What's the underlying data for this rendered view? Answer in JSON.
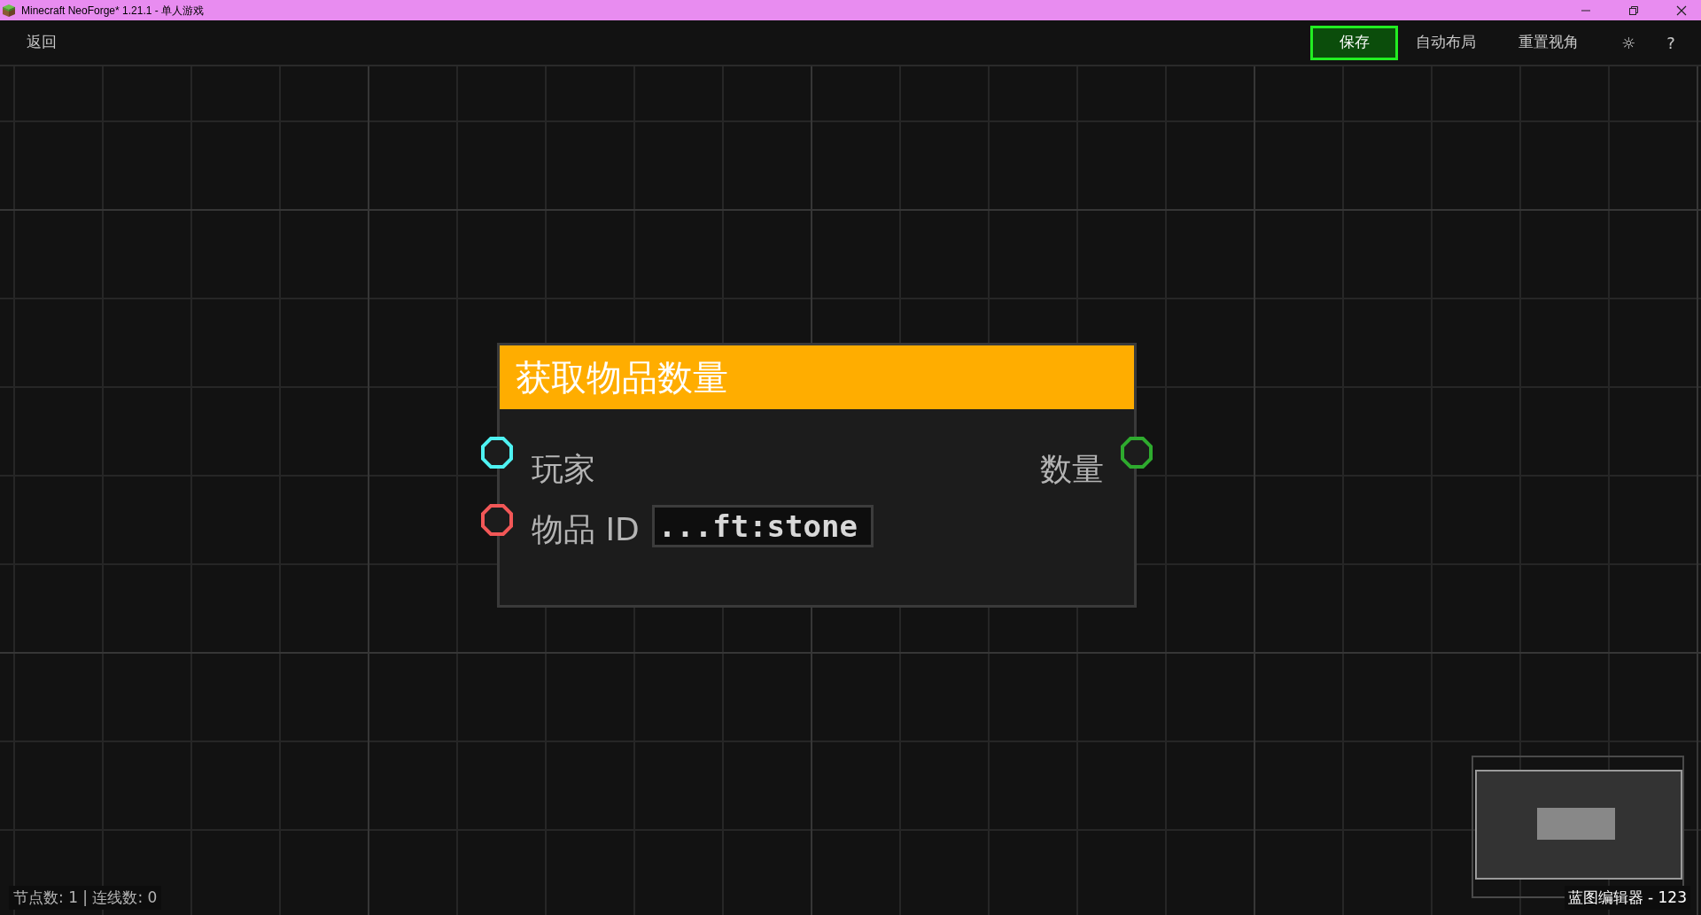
{
  "window": {
    "title": "Minecraft NeoForge* 1.21.1 - 单人游戏"
  },
  "toolbar": {
    "back": "返回",
    "buttons": [
      {
        "label": "保存",
        "kind": "primary"
      },
      {
        "label": "自动布局",
        "kind": "plain"
      },
      {
        "label": "重置视角",
        "kind": "plain"
      },
      {
        "label": "☼",
        "kind": "icon"
      },
      {
        "label": "?",
        "kind": "icon"
      }
    ]
  },
  "node": {
    "title": "获取物品数量",
    "inputs": [
      {
        "label": "玩家",
        "color": "#4ef2f2"
      },
      {
        "label": "物品 ID",
        "color": "#f25757",
        "value": "...ft:stone"
      }
    ],
    "outputs": [
      {
        "label": "数量",
        "color": "#2eaa2e"
      }
    ]
  },
  "status_bar": {
    "counts": "节点数: 1 | 连线数: 0",
    "editor_label": "蓝图编辑器 - 123"
  }
}
